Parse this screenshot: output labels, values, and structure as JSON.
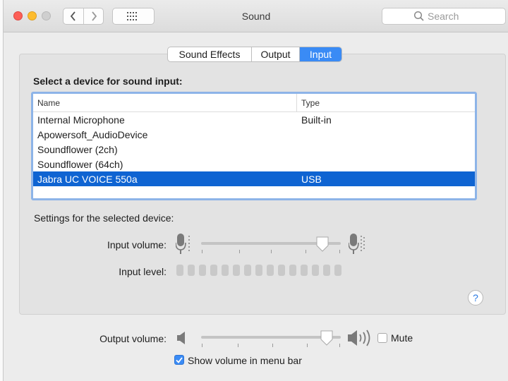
{
  "window": {
    "title": "Sound"
  },
  "search": {
    "placeholder": "Search"
  },
  "tabs": [
    {
      "label": "Sound Effects",
      "active": false
    },
    {
      "label": "Output",
      "active": false
    },
    {
      "label": "Input",
      "active": true
    }
  ],
  "input": {
    "heading": "Select a device for sound input:",
    "columns": {
      "name": "Name",
      "type": "Type"
    },
    "devices": [
      {
        "name": "Internal Microphone",
        "type": "Built-in",
        "selected": false
      },
      {
        "name": "Apowersoft_AudioDevice",
        "type": "",
        "selected": false
      },
      {
        "name": "Soundflower (2ch)",
        "type": "",
        "selected": false
      },
      {
        "name": "Soundflower (64ch)",
        "type": "",
        "selected": false
      },
      {
        "name": "Jabra UC VOICE 550a",
        "type": "USB",
        "selected": true
      }
    ],
    "settings_heading": "Settings for the selected device:",
    "volume_label": "Input volume:",
    "volume_level": 0.87,
    "level_label": "Input level:",
    "level_segments": 15,
    "level_active": 0
  },
  "footer": {
    "output_volume_label": "Output volume:",
    "output_volume_level": 0.9,
    "mute_label": "Mute",
    "mute_checked": false,
    "show_volume_label": "Show volume in menu bar",
    "show_volume_checked": true
  },
  "help": {
    "label": "?"
  },
  "colors": {
    "accent": "#3a8bf5",
    "selection": "#0f64d2",
    "close": "#fc5f57",
    "minimize": "#fdbc2e"
  },
  "icons": [
    "close-icon",
    "minimize-icon",
    "zoom-icon",
    "chevron-left-icon",
    "chevron-right-icon",
    "grid-icon",
    "search-icon",
    "microphone-icon",
    "speaker-icon",
    "checkmark-icon"
  ]
}
